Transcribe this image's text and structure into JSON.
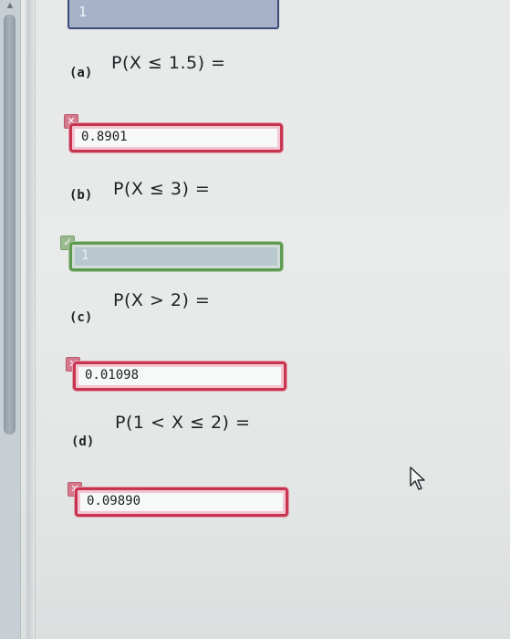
{
  "previous_answer": {
    "value": "1"
  },
  "questions": [
    {
      "label": "(a)",
      "expression": "P(X ≤ 1.5) =",
      "answer": "0.8901",
      "status": "incorrect"
    },
    {
      "label": "(b)",
      "expression": "P(X ≤ 3) =",
      "answer": "1",
      "status": "correct"
    },
    {
      "label": "(c)",
      "expression": "P(X > 2) =",
      "answer": "0.01098",
      "status": "incorrect"
    },
    {
      "label": "(d)",
      "expression": "P(1 < X ≤ 2) =",
      "answer": "0.09890",
      "status": "incorrect"
    }
  ],
  "icons": {
    "incorrect": "x-mark-icon",
    "correct": "check-mark-icon",
    "pointer": "mouse-pointer-icon"
  },
  "colors": {
    "incorrect_border": "#c8344f",
    "correct_border": "#5e9a52",
    "correct_fill": "#b9c7cf"
  }
}
